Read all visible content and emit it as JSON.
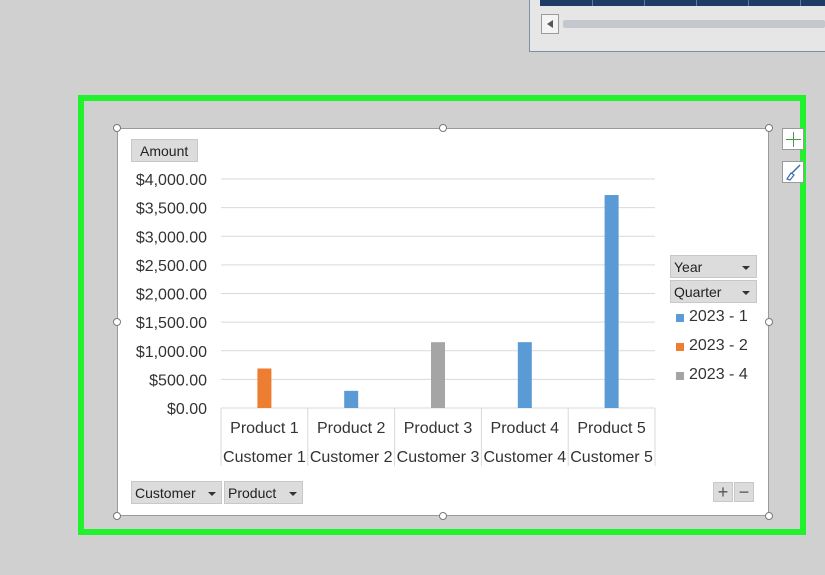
{
  "filters": {
    "amount": "Amount",
    "year": "Year",
    "quarter": "Quarter",
    "customer": "Customer",
    "product": "Product"
  },
  "expand_buttons": {
    "plus": "+",
    "minus": "−"
  },
  "colors": {
    "highlight": "#22f22e",
    "series1": "#5b9bd5",
    "series2": "#ed7d31",
    "series3": "#a5a5a5"
  },
  "chart_data": {
    "type": "bar",
    "categories": [
      {
        "product": "Product 1",
        "customer": "Customer 1"
      },
      {
        "product": "Product 2",
        "customer": "Customer 2"
      },
      {
        "product": "Product 3",
        "customer": "Customer 3"
      },
      {
        "product": "Product 4",
        "customer": "Customer 4"
      },
      {
        "product": "Product 5",
        "customer": "Customer 5"
      }
    ],
    "series": [
      {
        "name": "2023 - 1",
        "color": "#5b9bd5",
        "values": [
          null,
          300,
          null,
          1150,
          3720
        ]
      },
      {
        "name": "2023 - 2",
        "color": "#ed7d31",
        "values": [
          690,
          null,
          null,
          null,
          null
        ]
      },
      {
        "name": "2023 - 4",
        "color": "#a5a5a5",
        "values": [
          null,
          null,
          1150,
          null,
          null
        ]
      }
    ],
    "ylim": [
      0,
      4000
    ],
    "yticks": [
      "$0.00",
      "$500.00",
      "$1,000.00",
      "$1,500.00",
      "$2,000.00",
      "$2,500.00",
      "$3,000.00",
      "$3,500.00",
      "$4,000.00"
    ],
    "grid": true,
    "legend_position": "right"
  }
}
